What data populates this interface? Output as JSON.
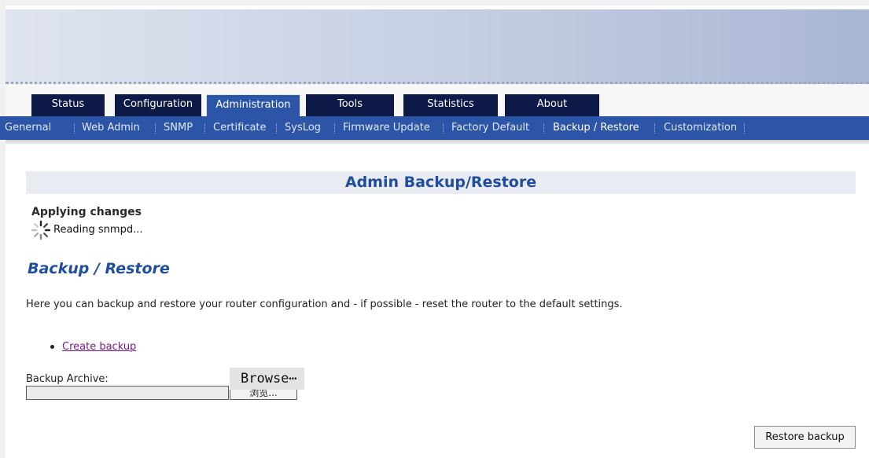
{
  "tabs": [
    {
      "label": "Status"
    },
    {
      "label": "Configuration"
    },
    {
      "label": "Administration"
    },
    {
      "label": "Tools"
    },
    {
      "label": "Statistics"
    },
    {
      "label": "About"
    }
  ],
  "subnav": [
    {
      "label": "Genernal"
    },
    {
      "label": "Web Admin"
    },
    {
      "label": "SNMP"
    },
    {
      "label": "Certificate"
    },
    {
      "label": "SysLog"
    },
    {
      "label": "Firmware Update"
    },
    {
      "label": "Factory Default"
    },
    {
      "label": "Backup / Restore"
    },
    {
      "label": "Customization"
    }
  ],
  "section_title": "Admin Backup/Restore",
  "status": {
    "applying": "Applying changes",
    "message": "Reading snmpd..."
  },
  "backup": {
    "heading": "Backup / Restore",
    "description": "Here you can backup and restore your router configuration and - if possible - reset the router to the default settings.",
    "create_link": "Create backup",
    "archive_label": "Backup Archive:",
    "browse_button": "浏览...",
    "browse_tooltip": "Browse⋯",
    "restore_button": "Restore backup"
  },
  "colors": {
    "nav_dark": "#0d1a47",
    "nav_blue": "#2c55a8",
    "heading_blue": "#1f4ea0",
    "link": "#7a1a8c"
  },
  "icons": {
    "spinner": "loading-spinner-icon"
  }
}
